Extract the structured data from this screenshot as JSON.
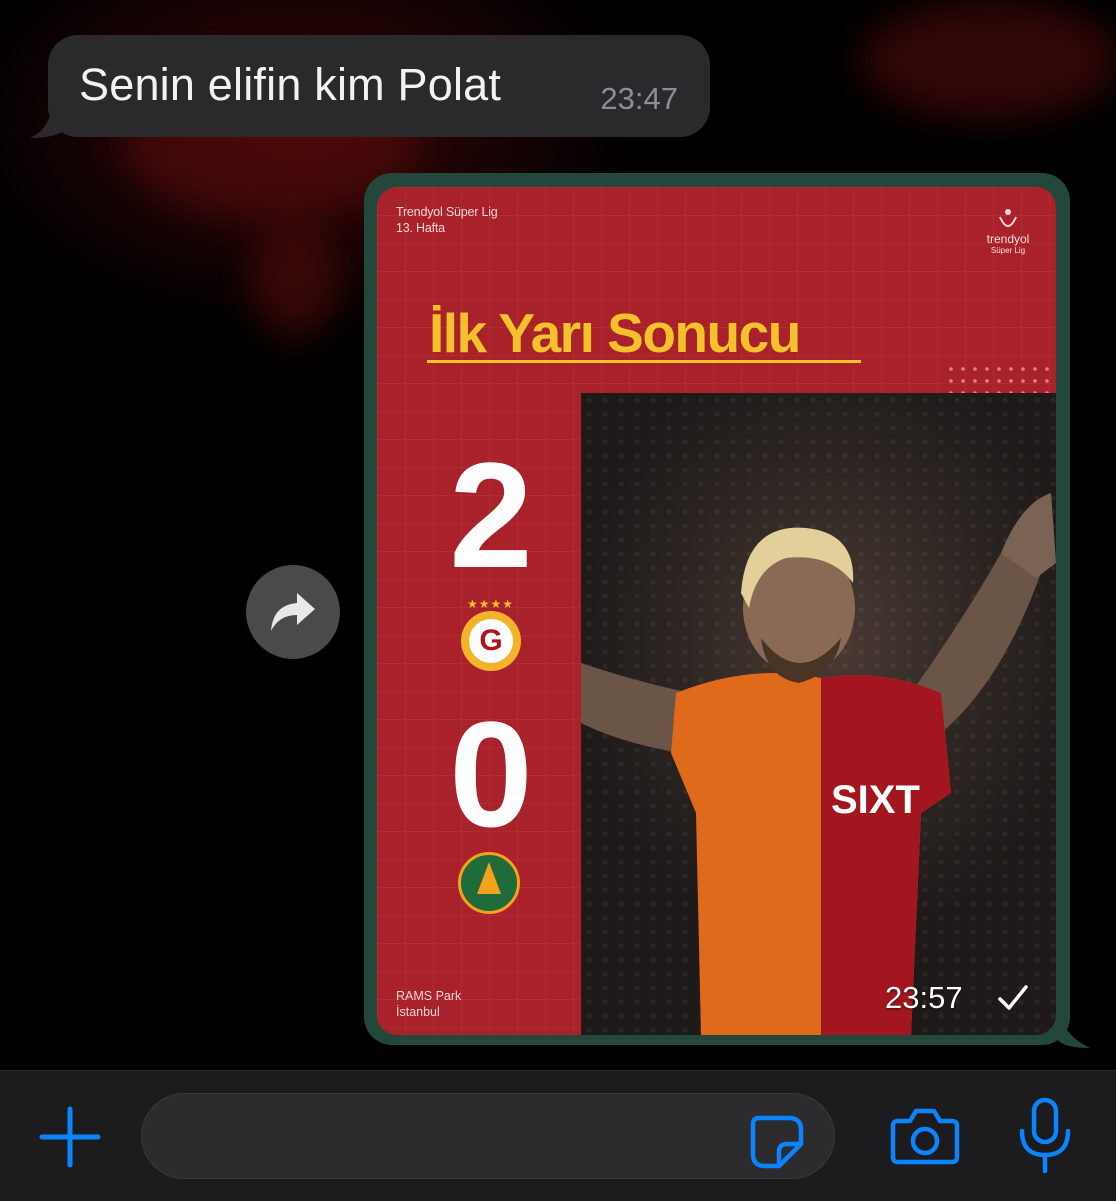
{
  "incoming_message": {
    "text": "Senin elifin kim Polat",
    "time": "23:47"
  },
  "image_message": {
    "league": "Trendyol Süper Lig",
    "week": "13. Hafta",
    "league_logo_text": "trendyol",
    "league_logo_sub": "Süper Lig",
    "headline": "İlk Yarı Sonucu",
    "home_score": "2",
    "away_score": "0",
    "home_crest_letter": "G",
    "venue_line1": "RAMS Park",
    "venue_line2": "İstanbul",
    "time": "23:57",
    "status": "sent"
  },
  "input_bar": {
    "placeholder": ""
  },
  "colors": {
    "accent_blue": "#0a84ff",
    "bubble_in": "#2a2a2c",
    "bubble_out_border": "#24473b",
    "poster_red": "#a9212a",
    "headline_yellow": "#f3c12b"
  },
  "icons": [
    "forward-icon",
    "plus-icon",
    "sticker-icon",
    "camera-icon",
    "microphone-icon",
    "checkmark-icon"
  ]
}
